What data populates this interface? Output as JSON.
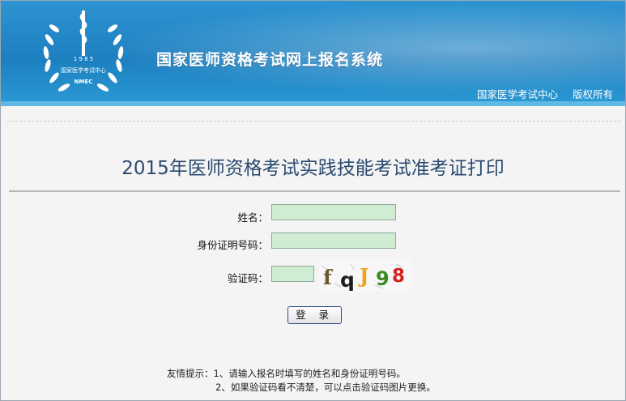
{
  "header": {
    "logo_text": {
      "year": "1 9 8 5",
      "org": "国家医学考试中心",
      "abbr": "NMEC"
    },
    "system_title": "国家医师资格考试网上报名系统",
    "links": [
      "国家医学考试中心",
      "版权所有"
    ]
  },
  "main": {
    "page_title": "2015年医师资格考试实践技能考试准考证打印",
    "form": {
      "name_label": "姓名：",
      "id_label": "身份证明号码：",
      "captcha_label": "验证码：",
      "captcha_chars": [
        "f",
        "q",
        "J",
        "9",
        "8"
      ],
      "captcha_colors": [
        "#6b5a2e",
        "#1e1e1e",
        "#f0a21a",
        "#3d8a24",
        "#d22323"
      ],
      "login_label": "登 录"
    },
    "tips": {
      "line1": "友情提示：1、请输入报名时填写的姓名和身份证明号码。",
      "line2": "2、如果验证码看不清楚，可以点击验证码图片更换。"
    }
  },
  "colors": {
    "header_blue": "#1d7fc0",
    "title_text": "#2a4a6f",
    "input_fill": "#d0ecd3"
  }
}
